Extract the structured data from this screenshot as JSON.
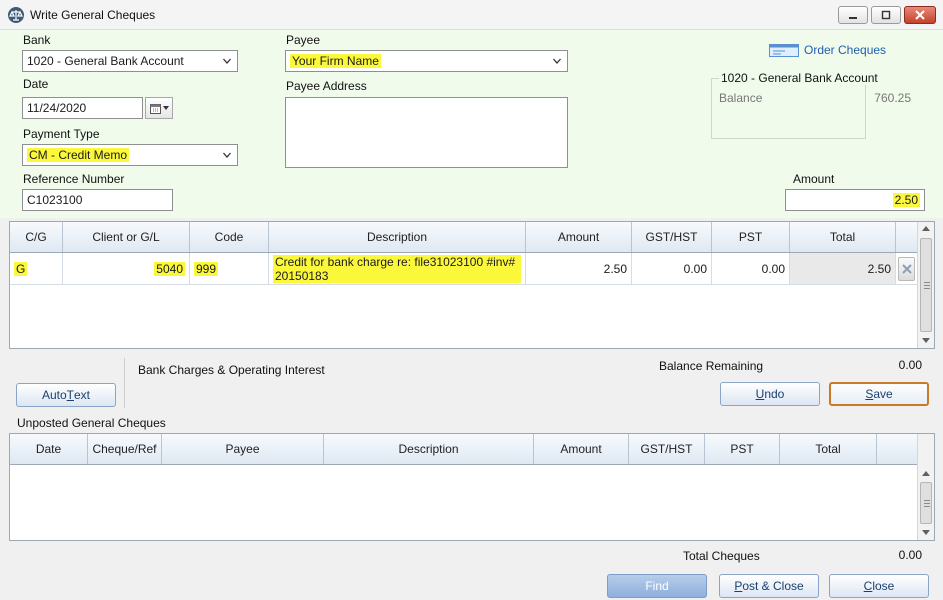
{
  "window": {
    "title": "Write General Cheques"
  },
  "form": {
    "bank_label": "Bank",
    "bank_value": "1020 - General Bank Account",
    "date_label": "Date",
    "date_value": "11/24/2020",
    "payment_type_label": "Payment Type",
    "payment_type_value": "CM - Credit Memo",
    "reference_label": "Reference Number",
    "reference_value": "C1023100",
    "payee_label": "Payee",
    "payee_value": "Your Firm Name",
    "payee_address_label": "Payee Address",
    "payee_address_value": "",
    "amount_label": "Amount",
    "amount_value": "2.50"
  },
  "order_cheques_label": "Order Cheques",
  "account_panel": {
    "title": "1020 - General Bank Account",
    "balance_label": "Balance",
    "balance_value": "760.25"
  },
  "entry_grid": {
    "columns": [
      "C/G",
      "Client or G/L",
      "Code",
      "Description",
      "Amount",
      "GST/HST",
      "PST",
      "Total"
    ],
    "rows": [
      {
        "cg": "G",
        "client_gl": "5040",
        "code": "999",
        "description": "Credit for bank charge re: file31023100 #inv# 20150183",
        "amount": "2.50",
        "gst_hst": "0.00",
        "pst": "0.00",
        "total": "2.50"
      }
    ]
  },
  "account_description": "Bank Charges & Operating Interest",
  "balance_remaining_label": "Balance Remaining",
  "balance_remaining_value": "0.00",
  "buttons": {
    "autotext_pre": "Auto",
    "autotext_key": "T",
    "autotext_post": "ext",
    "undo_key": "U",
    "undo_rest": "ndo",
    "save_key": "S",
    "save_rest": "ave",
    "find": "Find",
    "post_close_key": "P",
    "post_close_rest": "ost & Close",
    "close_key": "C",
    "close_rest": "lose"
  },
  "unposted": {
    "title": "Unposted General Cheques",
    "columns": [
      "Date",
      "Cheque/Ref",
      "Payee",
      "Description",
      "Amount",
      "GST/HST",
      "PST",
      "Total"
    ]
  },
  "total_cheques_label": "Total Cheques",
  "total_cheques_value": "0.00"
}
